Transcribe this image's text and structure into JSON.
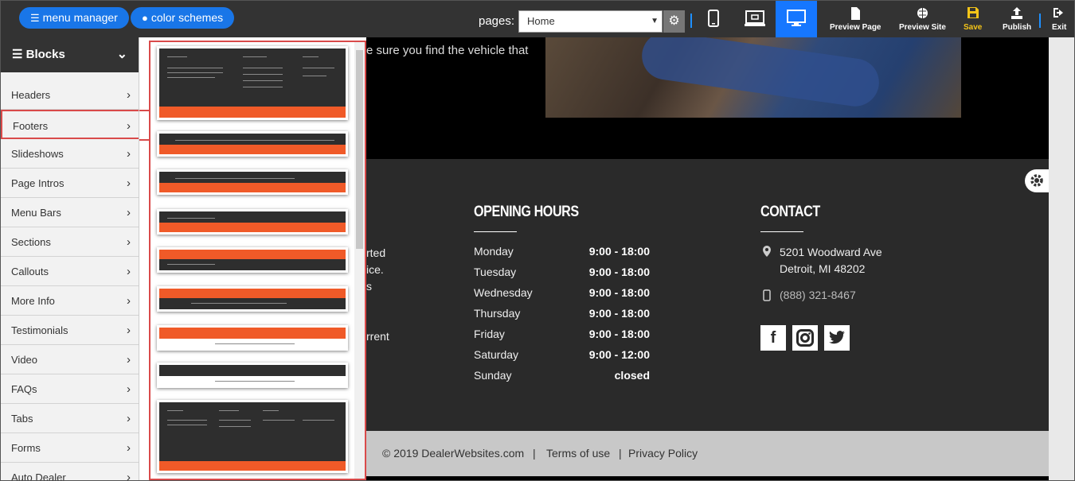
{
  "toolbar": {
    "menu_manager": "menu manager",
    "color_schemes": "color schemes",
    "pages_label": "pages:",
    "page_selected": "Home",
    "preview_page": "Preview Page",
    "preview_site": "Preview Site",
    "save": "Save",
    "publish": "Publish",
    "exit": "Exit"
  },
  "sidebar": {
    "title": "Blocks",
    "items": [
      "Headers",
      "Footers",
      "Slideshows",
      "Page Intros",
      "Menu Bars",
      "Sections",
      "Callouts",
      "More Info",
      "Testimonials",
      "Video",
      "FAQs",
      "Tabs",
      "Forms",
      "Auto Dealer"
    ],
    "active": "Footers"
  },
  "preview": {
    "hero_text": "e sure you find the vehicle that",
    "partial_text": [
      "rted",
      "ice.",
      "s",
      "rrent"
    ],
    "hours_title": "OPENING HOURS",
    "contact_title": "CONTACT",
    "hours": [
      {
        "day": "Monday",
        "time": "9:00 - 18:00"
      },
      {
        "day": "Tuesday",
        "time": "9:00 - 18:00"
      },
      {
        "day": "Wednesday",
        "time": "9:00 - 18:00"
      },
      {
        "day": "Thursday",
        "time": "9:00 - 18:00"
      },
      {
        "day": "Friday",
        "time": "9:00 - 18:00"
      },
      {
        "day": "Saturday",
        "time": "9:00 - 12:00"
      },
      {
        "day": "Sunday",
        "time": "closed"
      }
    ],
    "address_line1": "5201 Woodward Ave",
    "address_line2": "Detroit, MI 48202",
    "phone": "(888) 321-8467",
    "copyright": "© 2019  DealerWebsites.com",
    "sep": "|",
    "terms": "Terms of use",
    "privacy": "Privacy Policy"
  },
  "colors": {
    "accent_blue": "#1976e8",
    "highlight_red": "#d94a4a",
    "footer_orange": "#f05a28",
    "save_yellow": "#f5c518"
  }
}
